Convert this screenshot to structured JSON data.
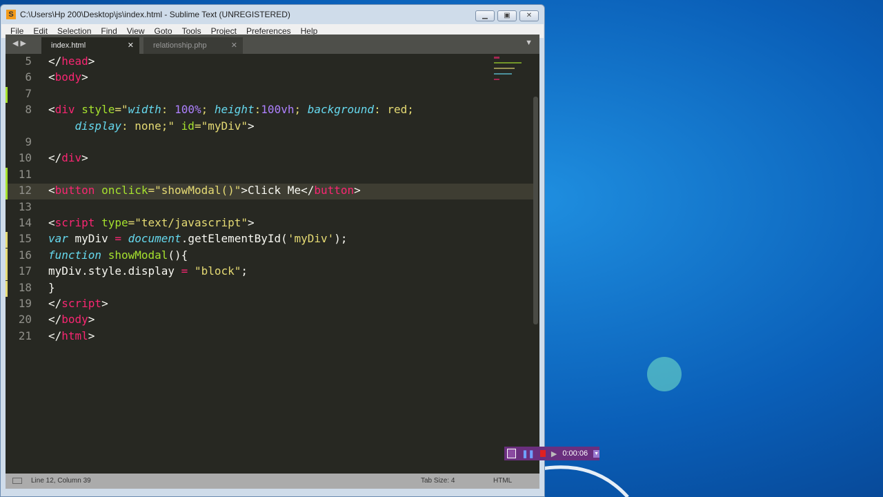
{
  "window": {
    "title": "C:\\Users\\Hp 200\\Desktop\\js\\index.html - Sublime Text (UNREGISTERED)"
  },
  "menu": [
    "File",
    "Edit",
    "Selection",
    "Find",
    "View",
    "Goto",
    "Tools",
    "Project",
    "Preferences",
    "Help"
  ],
  "tabs": [
    {
      "label": "index.html"
    },
    {
      "label": "relationship.php"
    }
  ],
  "colors": {
    "tag": "#f92672",
    "attr": "#a6e22e",
    "str": "#e6db74",
    "kw": "#66d9ef",
    "num": "#ae81ff",
    "txt": "#f8f8f2"
  },
  "lines": [
    {
      "n": "5",
      "toks": [
        [
          "</",
          "txt"
        ],
        [
          "head",
          "tag"
        ],
        [
          ">",
          "txt"
        ]
      ]
    },
    {
      "n": "6",
      "toks": [
        [
          "<",
          "txt"
        ],
        [
          "body",
          "tag"
        ],
        [
          ">",
          "txt"
        ]
      ]
    },
    {
      "n": "7",
      "toks": []
    },
    {
      "n": "8",
      "toks": [
        [
          "<",
          "txt"
        ],
        [
          "div",
          "tag"
        ],
        [
          " ",
          "txt"
        ],
        [
          "style",
          "attr"
        ],
        [
          "=\"",
          "str"
        ],
        [
          "width",
          "kwi"
        ],
        [
          ": ",
          "str"
        ],
        [
          "100%",
          "num"
        ],
        [
          "; ",
          "str"
        ],
        [
          "height",
          "kwi"
        ],
        [
          ":",
          "str"
        ],
        [
          "100vh",
          "num"
        ],
        [
          "; ",
          "str"
        ],
        [
          "background",
          "kwi"
        ],
        [
          ": ",
          "str"
        ],
        [
          "red",
          "str"
        ],
        [
          ";",
          "str"
        ]
      ]
    },
    {
      "n": "",
      "toks": [
        [
          "    ",
          "txt"
        ],
        [
          "display",
          "kwi"
        ],
        [
          ": none;\"",
          "str"
        ],
        [
          " ",
          "txt"
        ],
        [
          "id",
          "attr"
        ],
        [
          "=\"myDiv\"",
          "str"
        ],
        [
          ">",
          "txt"
        ]
      ]
    },
    {
      "n": "9",
      "toks": []
    },
    {
      "n": "10",
      "toks": [
        [
          "</",
          "txt"
        ],
        [
          "div",
          "tag"
        ],
        [
          ">",
          "txt"
        ]
      ]
    },
    {
      "n": "11",
      "toks": []
    },
    {
      "n": "12",
      "toks": [
        [
          "<",
          "txt"
        ],
        [
          "button",
          "tag"
        ],
        [
          " ",
          "txt"
        ],
        [
          "onclick",
          "attr"
        ],
        [
          "=\"showModal()\"",
          "str"
        ],
        [
          ">Click Me</",
          "txt"
        ],
        [
          "button",
          "tag"
        ],
        [
          ">",
          "txt"
        ]
      ]
    },
    {
      "n": "13",
      "toks": []
    },
    {
      "n": "14",
      "toks": [
        [
          "<",
          "txt"
        ],
        [
          "script",
          "tag"
        ],
        [
          " ",
          "txt"
        ],
        [
          "type",
          "attr"
        ],
        [
          "=\"text/javascript\"",
          "str"
        ],
        [
          ">",
          "txt"
        ]
      ]
    },
    {
      "n": "15",
      "toks": [
        [
          "var",
          "kwi"
        ],
        [
          " myDiv ",
          "txt"
        ],
        [
          "=",
          "tag"
        ],
        [
          " ",
          "txt"
        ],
        [
          "document",
          "kwi"
        ],
        [
          ".getElementById(",
          "txt"
        ],
        [
          "'myDiv'",
          "str"
        ],
        [
          ");",
          "txt"
        ]
      ]
    },
    {
      "n": "16",
      "toks": [
        [
          "function",
          "kwi"
        ],
        [
          " ",
          "txt"
        ],
        [
          "showModal",
          "attr"
        ],
        [
          "(){",
          "txt"
        ]
      ]
    },
    {
      "n": "17",
      "toks": [
        [
          "myDiv.style.display ",
          "txt"
        ],
        [
          "=",
          "tag"
        ],
        [
          " ",
          "txt"
        ],
        [
          "\"block\"",
          "str"
        ],
        [
          ";",
          "txt"
        ]
      ]
    },
    {
      "n": "18",
      "toks": [
        [
          "}",
          "txt"
        ]
      ]
    },
    {
      "n": "19",
      "toks": [
        [
          "</",
          "txt"
        ],
        [
          "script",
          "tag"
        ],
        [
          ">",
          "txt"
        ]
      ]
    },
    {
      "n": "20",
      "toks": [
        [
          "</",
          "txt"
        ],
        [
          "body",
          "tag"
        ],
        [
          ">",
          "txt"
        ]
      ]
    },
    {
      "n": "21",
      "toks": [
        [
          "</",
          "txt"
        ],
        [
          "html",
          "tag"
        ],
        [
          ">",
          "txt"
        ]
      ]
    }
  ],
  "status": {
    "position": "Line 12, Column 39",
    "tab_size": "Tab Size: 4",
    "syntax": "HTML"
  },
  "recorder": {
    "time": "0:00:06"
  }
}
